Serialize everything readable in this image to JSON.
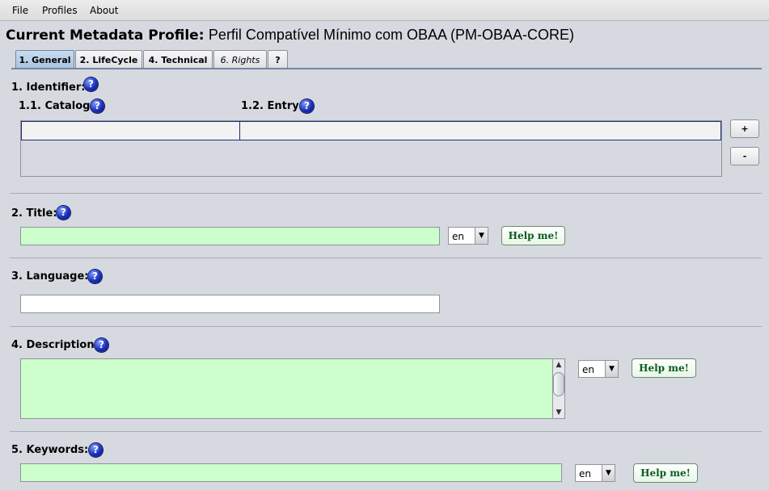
{
  "menu": {
    "file": "File",
    "profiles": "Profiles",
    "about": "About"
  },
  "profile": {
    "label": "Current Metadata Profile:",
    "name": "Perfil Compatível Mínimo com OBAA (PM-OBAA-CORE)"
  },
  "tabs": [
    {
      "label": "1. General",
      "active": true
    },
    {
      "label": "2. LifeCycle"
    },
    {
      "label": "4. Technical"
    },
    {
      "label": "6. Rights",
      "italic": true
    },
    {
      "label": "?"
    }
  ],
  "identifier": {
    "label": "1. Identifier:",
    "catalog_label": "1.1. Catalog",
    "entry_label": "1.2. Entry",
    "add_label": "+",
    "remove_label": "-",
    "catalog_value": "",
    "entry_value": ""
  },
  "title": {
    "label": "2. Title:",
    "value": "",
    "lang": "en",
    "help": "Help me!"
  },
  "language": {
    "label": "3. Language:",
    "value": ""
  },
  "description": {
    "label": "4. Description:",
    "value": "",
    "lang": "en",
    "help": "Help me!"
  },
  "keywords": {
    "label": "5. Keywords:",
    "value": "",
    "lang": "en",
    "help": "Help me!"
  },
  "help_icon_glyph": "?",
  "colors": {
    "required_field": "#ccffcc",
    "active_tab": "#a8c3df",
    "help_icon": "#1a2fb8"
  }
}
